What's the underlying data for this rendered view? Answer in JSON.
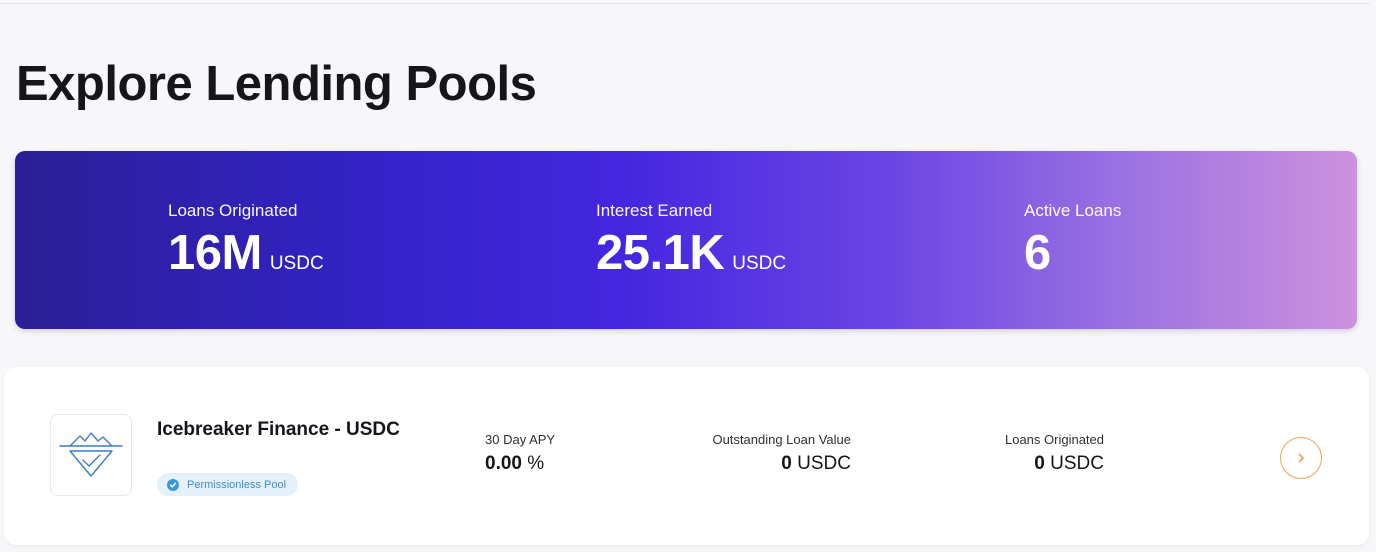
{
  "page": {
    "title": "Explore Lending Pools"
  },
  "stats": [
    {
      "label": "Loans Originated",
      "value": "16M",
      "unit": "USDC"
    },
    {
      "label": "Interest Earned",
      "value": "25.1K",
      "unit": "USDC"
    },
    {
      "label": "Active Loans",
      "value": "6",
      "unit": ""
    }
  ],
  "pool": {
    "name": "Icebreaker Finance - USDC",
    "badge": "Permissionless Pool",
    "logo_icon": "iceberg-check-logo",
    "metrics": [
      {
        "label": "30 Day APY",
        "value": "0.00",
        "unit": " %"
      },
      {
        "label": "Outstanding Loan Value",
        "value": "0",
        "unit": " USDC"
      },
      {
        "label": "Loans Originated",
        "value": "0",
        "unit": " USDC"
      }
    ],
    "action_icon": "chevron-right-icon"
  },
  "colors": {
    "banner_start": "#2b1f96",
    "banner_mid": "#4426e0",
    "banner_end": "#cc92dd",
    "badge_bg": "#e4f1fb",
    "badge_text": "#3e8ed0",
    "action_accent": "#f3a254",
    "logo_stroke": "#3a7fc0"
  }
}
